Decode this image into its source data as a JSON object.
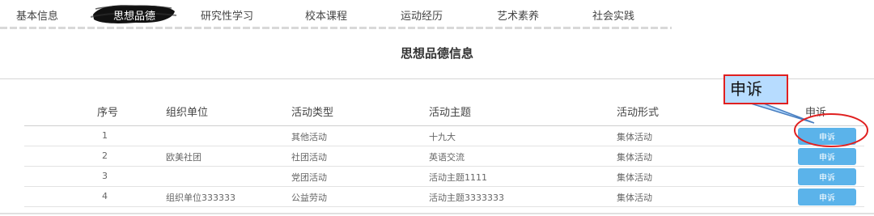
{
  "tabs": [
    {
      "label": "基本信息",
      "active": false
    },
    {
      "label": "思想品德",
      "active": true
    },
    {
      "label": "研究性学习",
      "active": false
    },
    {
      "label": "校本课程",
      "active": false
    },
    {
      "label": "运动经历",
      "active": false
    },
    {
      "label": "艺术素养",
      "active": false
    },
    {
      "label": "社会实践",
      "active": false
    }
  ],
  "title": "思想品德信息",
  "columns": [
    "序号",
    "组织单位",
    "活动类型",
    "活动主题",
    "活动形式",
    "申诉"
  ],
  "rows": [
    {
      "no": "1",
      "org": "",
      "type": "其他活动",
      "theme": "十九大",
      "form": "集体活动",
      "action": "申诉"
    },
    {
      "no": "2",
      "org": "欧美社团",
      "type": "社团活动",
      "theme": "英语交流",
      "form": "集体活动",
      "action": "申诉"
    },
    {
      "no": "3",
      "org": "",
      "type": "党团活动",
      "theme": "活动主题1111",
      "form": "集体活动",
      "action": "申诉"
    },
    {
      "no": "4",
      "org": "组织单位333333",
      "type": "公益劳动",
      "theme": "活动主题3333333",
      "form": "集体活动",
      "action": "申诉"
    }
  ],
  "annotation": {
    "callout_text": "申诉"
  },
  "colors": {
    "active_tab_brush": "#111111",
    "appeal_button": "#5bb3ea",
    "callout_fill": "#b7dcff",
    "callout_border": "#e02020"
  }
}
